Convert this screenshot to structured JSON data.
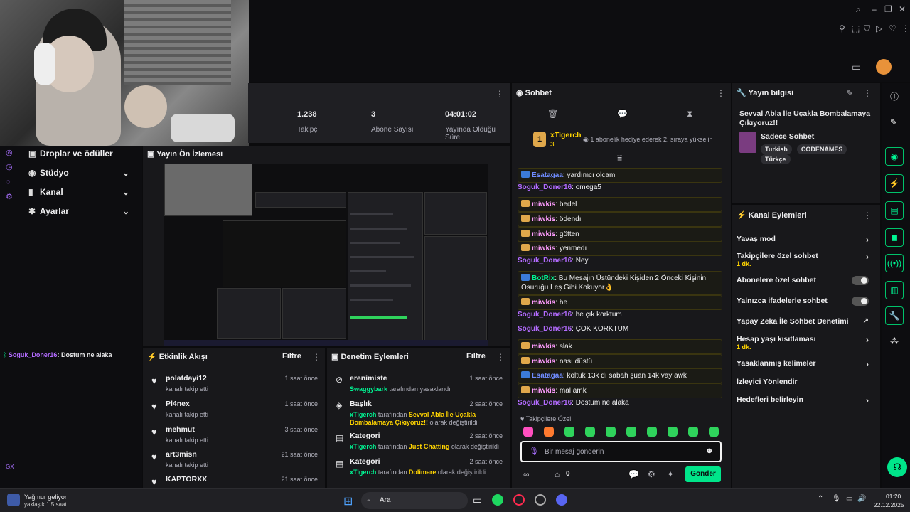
{
  "stats": {
    "followers_value": "1.238",
    "followers_label": "Takipçi",
    "subs_value": "3",
    "subs_label": "Abone Sayısı",
    "duration_value": "04:01:02",
    "duration_label": "Yayında Olduğu Süre"
  },
  "sidebar": {
    "items": [
      {
        "label": "Droplar ve ödüller"
      },
      {
        "label": "Stüdyo"
      },
      {
        "label": "Kanal"
      },
      {
        "label": "Ayarlar"
      }
    ],
    "chat_preview": {
      "user": "Soguk_Doner16",
      "text": ": Dostum ne alaka"
    },
    "gx": "GX"
  },
  "preview": {
    "title": "Yayın Ön İzlemesi"
  },
  "feed": {
    "title": "Etkinlik Akışı",
    "filter": "Filtre",
    "items": [
      {
        "name": "polatdayi12",
        "action": "kanalı takip etti",
        "time": "1 saat önce"
      },
      {
        "name": "Pl4nex",
        "action": "kanalı takip etti",
        "time": "1 saat önce"
      },
      {
        "name": "mehmut",
        "action": "kanalı takip etti",
        "time": "3 saat önce"
      },
      {
        "name": "art3misn",
        "action": "kanalı takip etti",
        "time": "21 saat önce"
      },
      {
        "name": "KAPTORXX",
        "action": "",
        "time": "21 saat önce"
      }
    ]
  },
  "mod": {
    "title": "Denetim Eylemleri",
    "filter": "Filtre",
    "items": [
      {
        "title": "erenimiste",
        "user": "Swaggybark",
        "rest": " tarafından yasaklandı",
        "time": "1 saat önce"
      },
      {
        "title": "Başlık",
        "user": "xTigerch",
        "rest": " tarafından ",
        "bold": "Sevval Abla İle Uçakla Bombalamaya Çıkıyoruz!!",
        "tail": " olarak değiştirildi",
        "time": "2 saat önce"
      },
      {
        "title": "Kategori",
        "user": "xTigerch",
        "rest": " tarafından ",
        "bold": "Just Chatting",
        "tail": " olarak değiştirildi",
        "time": "2 saat önce"
      },
      {
        "title": "Kategori",
        "user": "xTigerch",
        "rest": " tarafından ",
        "bold": "Dolimare",
        "tail": " olarak değiştirildi",
        "time": "2 saat önce"
      }
    ]
  },
  "chat": {
    "title": "Sohbet",
    "gifter": "xTigerch",
    "gifter_count": "3",
    "gift_note": "1 abonelik hediye ederek 2. sıraya yükselin",
    "messages": [
      {
        "user": "Esatagaa",
        "cls": "n-es",
        "text": ": yardımcı olcam",
        "boxed": true,
        "badge": "b"
      },
      {
        "user": "Soguk_Doner16",
        "cls": "n-sd",
        "text": ": omega5",
        "boxed": false
      },
      {
        "user": "miwkis",
        "cls": "n-mw",
        "text": ": bedel",
        "boxed": true,
        "badge": "y"
      },
      {
        "user": "miwkis",
        "cls": "n-mw",
        "text": ": ödendı",
        "boxed": true,
        "badge": "y"
      },
      {
        "user": "miwkis",
        "cls": "n-mw",
        "text": ": götten",
        "boxed": true,
        "badge": "y"
      },
      {
        "user": "miwkis",
        "cls": "n-mw",
        "text": ": yenmedı",
        "boxed": true,
        "badge": "y"
      },
      {
        "user": "Soguk_Doner16",
        "cls": "n-sd",
        "text": ": Ney",
        "boxed": false
      },
      {
        "user": "BotRix",
        "cls": "n-bx",
        "text": ": Bu Mesajın Üstündeki Kişiden 2 Önceki Kişinin Osuruğu Leş Gibi Kokuyor👌",
        "boxed": true,
        "badge": "b"
      },
      {
        "user": "miwkis",
        "cls": "n-mw",
        "text": ": he",
        "boxed": true,
        "badge": "y"
      },
      {
        "user": "Soguk_Doner16",
        "cls": "n-sd",
        "text": ": he çık korktum",
        "boxed": false
      },
      {
        "user": "Soguk_Doner16",
        "cls": "n-sd",
        "text": ": ÇOK KORKTUM",
        "boxed": false
      },
      {
        "user": "miwkis",
        "cls": "n-mw",
        "text": ": slak",
        "boxed": true,
        "badge": "y"
      },
      {
        "user": "miwkis",
        "cls": "n-mw",
        "text": ": nası düstü",
        "boxed": true,
        "badge": "y"
      },
      {
        "user": "Esatagaa",
        "cls": "n-es",
        "text": ": koltuk 13k dı sabah şuan 14k vay awk",
        "boxed": true,
        "badge": "b"
      },
      {
        "user": "miwkis",
        "cls": "n-mw",
        "text": ": mal amk",
        "boxed": true,
        "badge": "y"
      },
      {
        "user": "Soguk_Doner16",
        "cls": "n-sd",
        "text": ": Dostum ne alaka",
        "boxed": false
      }
    ],
    "followers_only_label": "Takipçilere Özel",
    "input_placeholder": "Bir mesaj gönderin",
    "points": "0",
    "send_label": "Gönder"
  },
  "info": {
    "title": "Yayın bilgisi",
    "stream_title": "Sevval Abla İle Uçakla Bombalamaya Çıkıyoruz!!",
    "category": "Sadece Sohbet",
    "tags": [
      "Turkish",
      "CODENAMES",
      "Türkçe"
    ]
  },
  "actions": {
    "title": "Kanal Eylemleri",
    "items": [
      {
        "label": "Yavaş mod",
        "sub": "",
        "kind": "chev"
      },
      {
        "label": "Takipçilere özel sohbet",
        "sub": "1 dk.",
        "kind": "chev"
      },
      {
        "label": "Abonelere özel sohbet",
        "sub": "",
        "kind": "toggle"
      },
      {
        "label": "Yalnızca ifadelerle sohbet",
        "sub": "",
        "kind": "toggle"
      },
      {
        "label": "Yapay Zeka İle Sohbet Denetimi",
        "sub": "",
        "kind": "ext"
      },
      {
        "label": "Hesap yaşı kısıtlaması",
        "sub": "1 dk.",
        "kind": "chev"
      },
      {
        "label": "Yasaklanmış kelimeler",
        "sub": "",
        "kind": "chev"
      },
      {
        "label": "İzleyici Yönlendir",
        "sub": "",
        "kind": "none"
      },
      {
        "label": "Hedefleri belirleyin",
        "sub": "",
        "kind": "chev"
      }
    ]
  },
  "taskbar": {
    "weather_title": "Yağmur geliyor",
    "weather_sub": "yaklaşık 1.5 saat...",
    "search": "Ara",
    "time": "01:20",
    "date": "22.12.2025"
  }
}
